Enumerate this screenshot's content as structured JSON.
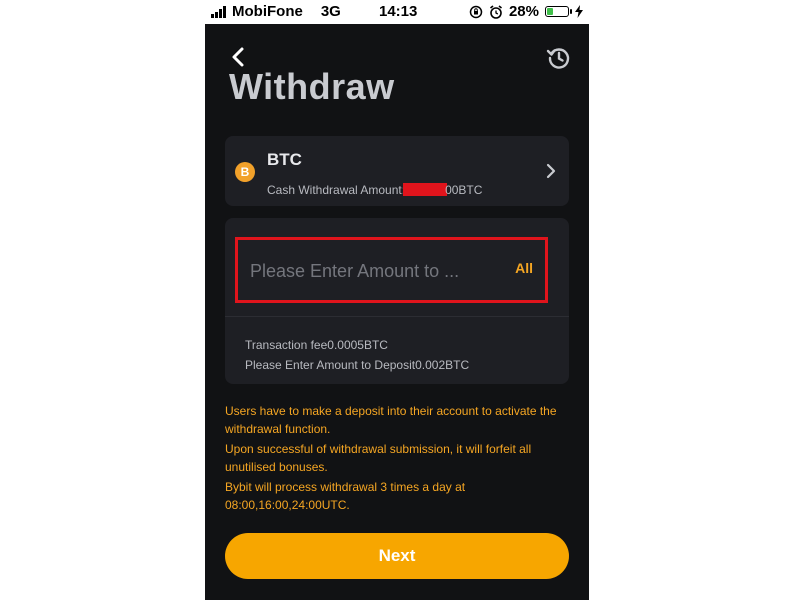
{
  "status_bar": {
    "carrier": "MobiFone",
    "network": "3G",
    "time": "14:13",
    "battery": "28%"
  },
  "header": {
    "back_icon": "chevron-left-icon",
    "history_icon": "history-icon",
    "title": "Withdraw"
  },
  "coin": {
    "icon": "bitcoin-icon",
    "icon_glyph": "B",
    "name": "BTC",
    "amount_label": "Cash Withdrawal Amount:",
    "amount_suffix": "00BTC"
  },
  "amount": {
    "placeholder": "Please Enter Amount to ...",
    "all_label": "All",
    "fee_text": "Transaction fee0.0005BTC",
    "minimum_text": "Please Enter Amount to Deposit0.002BTC"
  },
  "notices": [
    "Users have to make a deposit into their account to activate the withdrawal function.",
    "Upon successful of withdrawal submission, it will forfeit all unutilised bonuses.",
    "Bybit will process withdrawal 3 times a day at 08:00,16:00,24:00UTC."
  ],
  "next_label": "Next",
  "colors": {
    "background": "#111214",
    "card": "#1e1f24",
    "accent": "#f7a600",
    "highlight_border": "#e0141c",
    "battery_green": "#3fbf4a"
  }
}
